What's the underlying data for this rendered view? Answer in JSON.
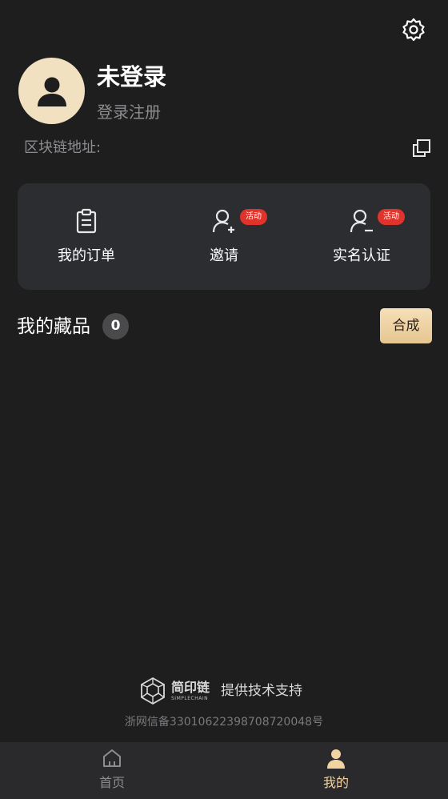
{
  "header": {
    "settings_icon": "gear-icon"
  },
  "profile": {
    "avatar_icon": "user-avatar-icon",
    "username": "未登录",
    "login_link": "登录注册",
    "chain_address_label": "区块链地址:",
    "copy_icon": "copy-icon"
  },
  "menu": {
    "items": [
      {
        "label": "我的订单",
        "icon": "clipboard-icon",
        "badge": ""
      },
      {
        "label": "邀请",
        "icon": "user-add-icon",
        "badge": "活动"
      },
      {
        "label": "实名认证",
        "icon": "user-verify-icon",
        "badge": "活动"
      }
    ]
  },
  "collection": {
    "title": "我的藏品",
    "count": "0",
    "compose_button": "合成"
  },
  "footer": {
    "brand_cn": "简印链",
    "brand_en": "SIMPLECHAIN",
    "support_text": "提供技术支持",
    "icp": "浙网信备33010622398708720048号"
  },
  "tabbar": {
    "tabs": [
      {
        "label": "首页",
        "icon": "home-icon",
        "active": false
      },
      {
        "label": "我的",
        "icon": "person-icon",
        "active": true
      }
    ]
  },
  "colors": {
    "background": "#1e1e1f",
    "card": "#2c2d30",
    "accent_gold": "#f2d3a2",
    "badge_red": "#e0332c",
    "muted_text": "#8d8d90"
  }
}
